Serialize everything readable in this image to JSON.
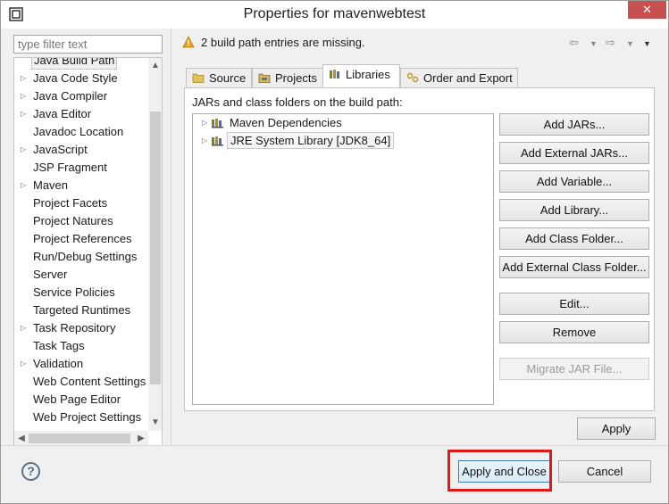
{
  "window": {
    "title": "Properties for mavenwebtest",
    "close_label": "✕"
  },
  "filter": {
    "placeholder": "type filter text"
  },
  "nav_tree": {
    "items": [
      {
        "label": "Java Build Path",
        "expandable": false,
        "selected": true
      },
      {
        "label": "Java Code Style",
        "expandable": true
      },
      {
        "label": "Java Compiler",
        "expandable": true
      },
      {
        "label": "Java Editor",
        "expandable": true
      },
      {
        "label": "Javadoc Location",
        "expandable": false
      },
      {
        "label": "JavaScript",
        "expandable": true
      },
      {
        "label": "JSP Fragment",
        "expandable": false
      },
      {
        "label": "Maven",
        "expandable": true
      },
      {
        "label": "Project Facets",
        "expandable": false
      },
      {
        "label": "Project Natures",
        "expandable": false
      },
      {
        "label": "Project References",
        "expandable": false
      },
      {
        "label": "Run/Debug Settings",
        "expandable": false
      },
      {
        "label": "Server",
        "expandable": false
      },
      {
        "label": "Service Policies",
        "expandable": false
      },
      {
        "label": "Targeted Runtimes",
        "expandable": false
      },
      {
        "label": "Task Repository",
        "expandable": true
      },
      {
        "label": "Task Tags",
        "expandable": false
      },
      {
        "label": "Validation",
        "expandable": true
      },
      {
        "label": "Web Content Settings",
        "expandable": false
      },
      {
        "label": "Web Page Editor",
        "expandable": false
      },
      {
        "label": "Web Project Settings",
        "expandable": false
      }
    ]
  },
  "message": {
    "text": "2 build path entries are missing.",
    "icon": "warning-icon"
  },
  "tabs": [
    {
      "label": "Source",
      "icon": "source-folder-icon"
    },
    {
      "label": "Projects",
      "icon": "projects-icon"
    },
    {
      "label": "Libraries",
      "icon": "libraries-icon",
      "active": true
    },
    {
      "label": "Order and Export",
      "icon": "order-export-icon"
    }
  ],
  "libraries": {
    "caption": "JARs and class folders on the build path:",
    "entries": [
      {
        "label": "Maven Dependencies"
      },
      {
        "label": "JRE System Library [JDK8_64]"
      }
    ],
    "buttons": [
      {
        "label": "Add JARs...",
        "enabled": true
      },
      {
        "label": "Add External JARs...",
        "enabled": true
      },
      {
        "label": "Add Variable...",
        "enabled": true
      },
      {
        "label": "Add Library...",
        "enabled": true
      },
      {
        "label": "Add Class Folder...",
        "enabled": true
      },
      {
        "label": "Add External Class Folder...",
        "enabled": true
      },
      {
        "label": "Edit...",
        "enabled": true
      },
      {
        "label": "Remove",
        "enabled": true
      },
      {
        "label": "Migrate JAR File...",
        "enabled": false
      }
    ]
  },
  "footer": {
    "apply_label": "Apply",
    "apply_close_label": "Apply and Close",
    "cancel_label": "Cancel",
    "help_label": "?"
  },
  "colors": {
    "highlight": "#e01818",
    "close_button": "#c75050",
    "warning": "#e8a31c"
  }
}
